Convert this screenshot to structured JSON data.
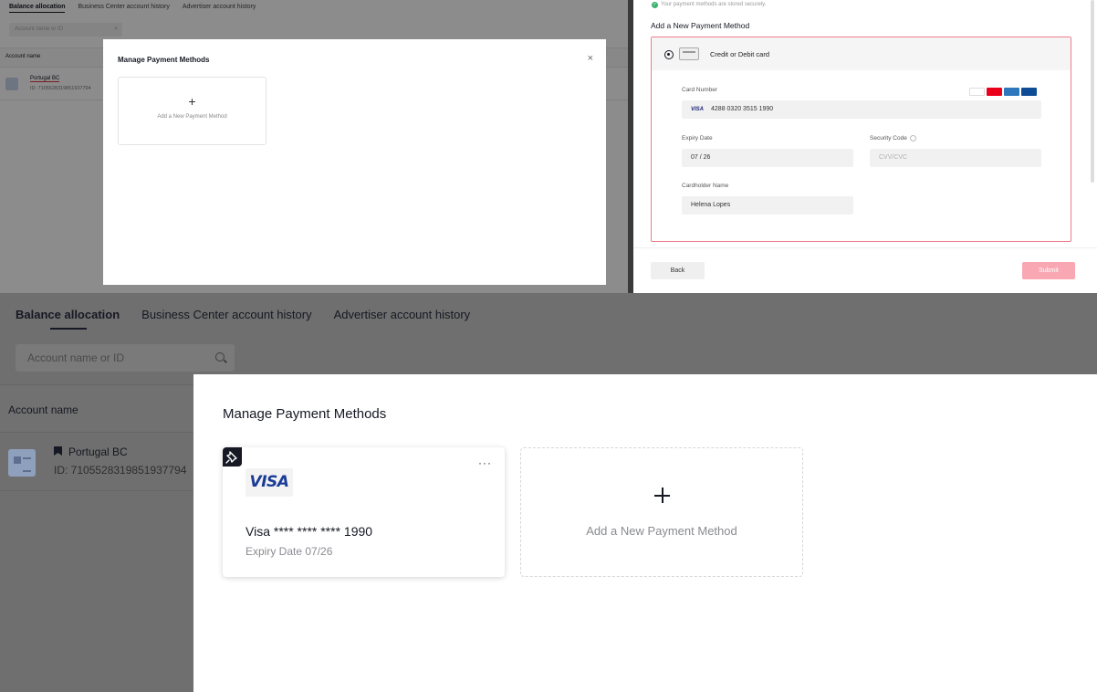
{
  "top_left": {
    "tabs": [
      "Balance allocation",
      "Business Center account history",
      "Advertiser account history"
    ],
    "search_placeholder": "Account name or ID",
    "column_account_name": "Account name",
    "account": {
      "name": "Portugal BC",
      "id": "ID: 7105528319851937794"
    },
    "modal": {
      "title": "Manage Payment Methods",
      "close": "×",
      "add_plus": "+",
      "add_label": "Add a New Payment Method"
    }
  },
  "top_right": {
    "secure_note": "Your payment methods are stored securely.",
    "heading": "Add a New Payment Method",
    "option_label": "Credit or Debit card",
    "card_number_label": "Card Number",
    "card_number_value": "4288 0320 3515 1990",
    "card_brand_tag": "VISA",
    "accepted_brands": [
      "visa",
      "mastercard",
      "amex",
      "jcb"
    ],
    "expiry_label": "Expiry Date",
    "expiry_month": "07",
    "expiry_sep": "/",
    "expiry_year": "26",
    "security_label": "Security Code",
    "security_placeholder": "CVV/CVC",
    "cardholder_label": "Cardholder Name",
    "cardholder_value": "Helena Lopes",
    "back_label": "Back",
    "submit_label": "Submit",
    "colors": {
      "accent_border": "#f07c8d",
      "submit_disabled": "#f9a8b3"
    }
  },
  "main": {
    "tabs": [
      "Balance allocation",
      "Business Center account history",
      "Advertiser account history"
    ],
    "search_placeholder": "Account name or ID",
    "column_account_name": "Account name",
    "account": {
      "name": "Portugal BC",
      "id": "ID: 7105528319851937794"
    },
    "modal": {
      "title": "Manage Payment Methods",
      "saved_card": {
        "brand": "VISA",
        "number": "Visa **** **** **** 1990",
        "expiry": "Expiry Date 07/26",
        "more": "···"
      },
      "add_label": "Add a New Payment Method"
    }
  }
}
